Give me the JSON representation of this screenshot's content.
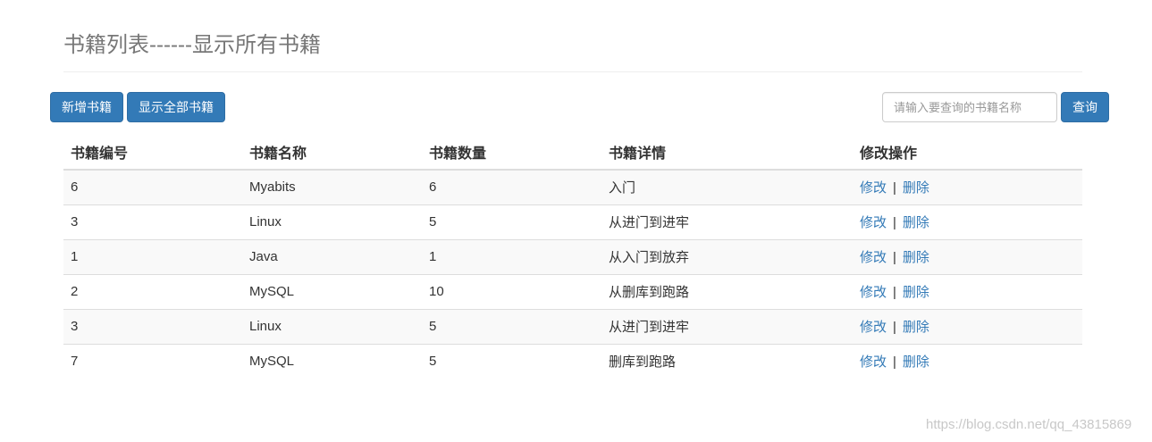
{
  "header": {
    "title": "书籍列表------显示所有书籍"
  },
  "toolbar": {
    "add_label": "新增书籍",
    "show_all_label": "显示全部书籍",
    "search_placeholder": "请输入要查询的书籍名称",
    "search_value": "",
    "query_label": "查询"
  },
  "table": {
    "headers": [
      "书籍编号",
      "书籍名称",
      "书籍数量",
      "书籍详情",
      "修改操作"
    ],
    "rows": [
      {
        "id": "6",
        "name": "Myabits",
        "count": "6",
        "detail": "入门"
      },
      {
        "id": "3",
        "name": "Linux",
        "count": "5",
        "detail": "从进门到进牢"
      },
      {
        "id": "1",
        "name": "Java",
        "count": "1",
        "detail": "从入门到放弃"
      },
      {
        "id": "2",
        "name": "MySQL",
        "count": "10",
        "detail": "从删库到跑路"
      },
      {
        "id": "3",
        "name": "Linux",
        "count": "5",
        "detail": "从进门到进牢"
      },
      {
        "id": "7",
        "name": "MySQL",
        "count": "5",
        "detail": "删库到跑路"
      }
    ],
    "edit_label": "修改",
    "separator": "|",
    "delete_label": "删除"
  },
  "watermark": "https://blog.csdn.net/qq_43815869",
  "colors": {
    "primary": "#337ab7",
    "title": "#777777",
    "row_stripe": "#f9f9f9"
  }
}
